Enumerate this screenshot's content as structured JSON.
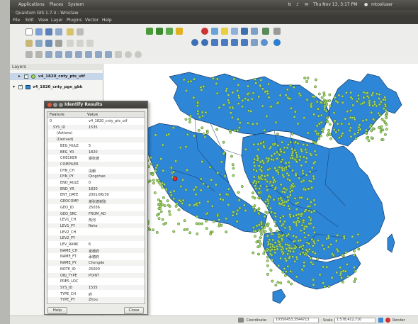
{
  "top_panel": {
    "menus": [
      "Applications",
      "Places",
      "System"
    ],
    "clock": "Thu Nov 13, 3:17 PM",
    "user": "mtooluser"
  },
  "window": {
    "title": "Quantum GIS 1.7.4 - Wroclaw"
  },
  "menubar": {
    "items": [
      "File",
      "Edit",
      "View",
      "Layer",
      "Plugins",
      "Vector",
      "Help"
    ]
  },
  "layers_panel": {
    "title": "Layers",
    "layers": [
      {
        "name": "v4_1820_cnty_pts_utf",
        "checked": true
      },
      {
        "name": "v4_1820_cnty_pgn_gbk",
        "checked": true
      }
    ]
  },
  "identify": {
    "title": "Identify Results",
    "col_feature": "Feature",
    "col_value": "Value",
    "rows": [
      {
        "f": "0",
        "v": "v4_1820_cnty_pts_utf",
        "indent": 0
      },
      {
        "f": "SYS_ID",
        "v": "1535",
        "indent": 1
      },
      {
        "f": "(Actions)",
        "v": "",
        "indent": 2
      },
      {
        "f": "(Derived)",
        "v": "",
        "indent": 2
      },
      {
        "f": "BEG_RULE",
        "v": "5",
        "indent": 3
      },
      {
        "f": "BEG_YR",
        "v": "1820",
        "indent": 3
      },
      {
        "f": "CHECKER",
        "v": "谢张德",
        "indent": 3
      },
      {
        "f": "COMPILER",
        "v": "",
        "indent": 3
      },
      {
        "f": "DYN_CH",
        "v": "清朝",
        "indent": 3
      },
      {
        "f": "DYN_PY",
        "v": "Qingchao",
        "indent": 3
      },
      {
        "f": "END_RULE",
        "v": "0",
        "indent": 3
      },
      {
        "f": "END_YR",
        "v": "1820",
        "indent": 3
      },
      {
        "f": "ENT_DATE",
        "v": "2001/06/30",
        "indent": 3
      },
      {
        "f": "GEOCOMP",
        "v": "谢张德谢张",
        "indent": 3
      },
      {
        "f": "GEO_ID",
        "v": "25036",
        "indent": 3
      },
      {
        "f": "GEO_SRC",
        "v": "FROM_AD",
        "indent": 3
      },
      {
        "f": "LEV1_CH",
        "v": "热河",
        "indent": 3
      },
      {
        "f": "LEV1_PY",
        "v": "Rehe",
        "indent": 3
      },
      {
        "f": "LEV2_CH",
        "v": "",
        "indent": 3
      },
      {
        "f": "LEV2_PY",
        "v": "",
        "indent": 3
      },
      {
        "f": "LEV_RANK",
        "v": "6",
        "indent": 3
      },
      {
        "f": "NAME_CH",
        "v": "承德府",
        "indent": 3
      },
      {
        "f": "NAME_FT",
        "v": "承德府",
        "indent": 3
      },
      {
        "f": "NAME_PY",
        "v": "Chengde",
        "indent": 3
      },
      {
        "f": "NOTE_ID",
        "v": "25000",
        "indent": 3
      },
      {
        "f": "OBJ_TYPE",
        "v": "POINT",
        "indent": 3
      },
      {
        "f": "PRES_LOC",
        "v": "",
        "indent": 3
      },
      {
        "f": "SYS_ID",
        "v": "1535",
        "indent": 3
      },
      {
        "f": "TYPE_CH",
        "v": "府",
        "indent": 3
      },
      {
        "f": "TYPE_PY",
        "v": "Zhou",
        "indent": 3
      }
    ],
    "help_button": "Help",
    "close_button": "Close"
  },
  "status": {
    "coord_label": "Coordinate:",
    "coord_value": "10350453,3544713",
    "scale_label": "Scale",
    "scale_value": "1:578,412,710",
    "render_label": "Render"
  },
  "colors": {
    "polygon_fill": "#2e86d6",
    "polygon_stroke": "#123a66",
    "point_fill": "#a6d96a",
    "point_stroke": "#3d6b1e",
    "highlight_point": "#e03030"
  }
}
